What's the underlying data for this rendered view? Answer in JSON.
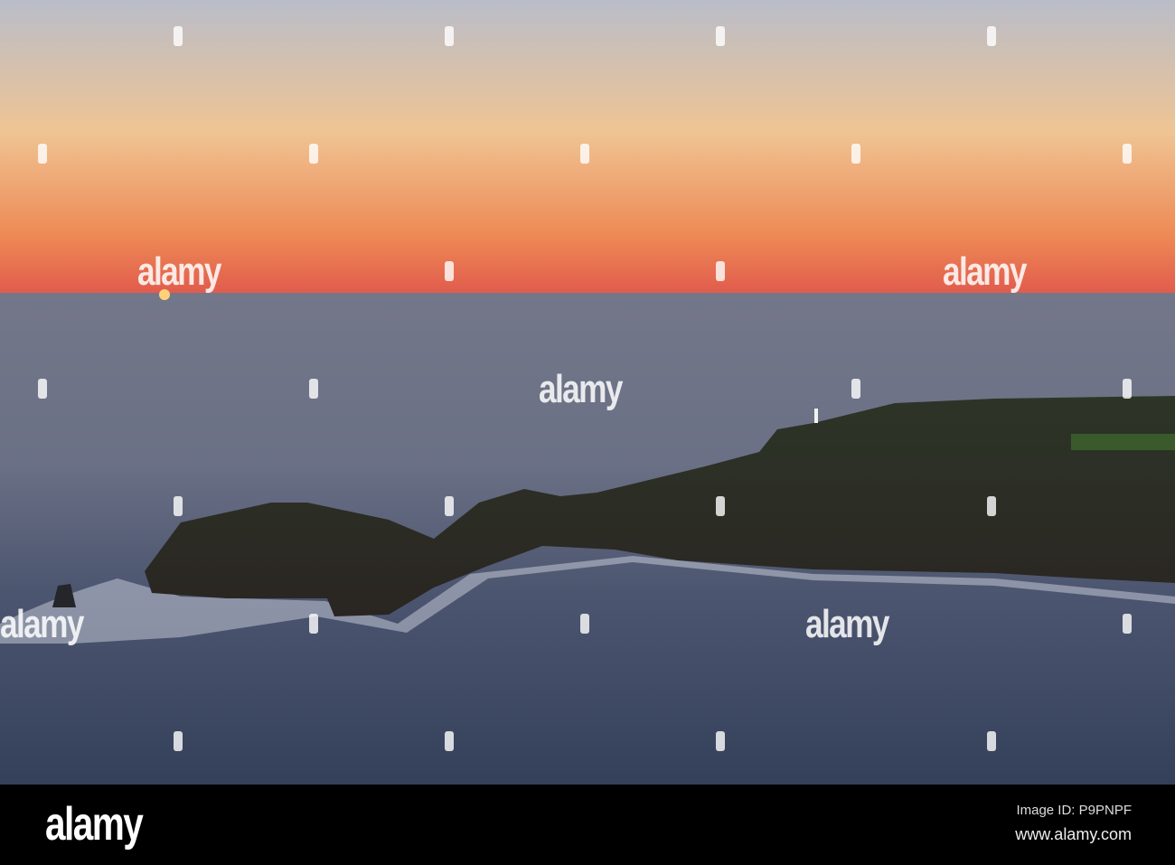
{
  "watermark": {
    "text": "alamy"
  },
  "footer": {
    "logo": "alamy",
    "image_id": "Image ID: P9PNPF",
    "url": "www.alamy.com"
  },
  "colors": {
    "sky_top": "#b9bdc9",
    "sky_mid": "#efc493",
    "sky_low": "#ee8a55",
    "horizon": "#e15b4c",
    "sea_far": "#737789",
    "sea_near": "#34405a",
    "land": "#272b25"
  }
}
